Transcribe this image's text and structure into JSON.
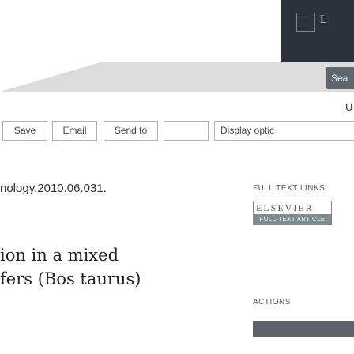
{
  "header": {
    "logo_letter": "L"
  },
  "search": {
    "button_label": "Sea"
  },
  "account": {
    "user_fragment": "U"
  },
  "toolbar": {
    "save_label": "Save",
    "email_label": "Email",
    "send_to_label": "Send to",
    "display_options_label": "Display optic"
  },
  "article": {
    "doi_fragment": "nology.2010.06.031.",
    "title_line1": "ion in a mixed",
    "title_line2": "fers (Bos taurus)"
  },
  "sidebar": {
    "full_text_links_label": "FULL TEXT LINKS",
    "elsevier_logo_text": "ELSEVIER",
    "elsevier_badge_text": "FULL-TEXT ARTICLE",
    "actions_label": "ACTIONS"
  }
}
